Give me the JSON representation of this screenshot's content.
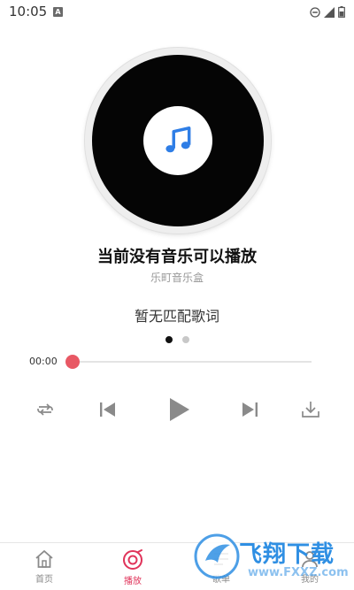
{
  "status_bar": {
    "time": "10:05",
    "app_icon_letter": "A"
  },
  "player": {
    "song_title": "当前没有音乐可以播放",
    "artist": "乐町音乐盒",
    "lyrics": "暂无匹配歌词",
    "current_time": "00:00",
    "progress": 0,
    "page_indicator": {
      "count": 2,
      "active": 0
    }
  },
  "controls": [
    "repeat-icon",
    "previous-icon",
    "play-icon",
    "next-icon",
    "download-icon"
  ],
  "bottom_nav": {
    "items": [
      {
        "label": "首页",
        "icon": "home-icon",
        "active": false
      },
      {
        "label": "播放",
        "icon": "play-disc-icon",
        "active": true
      },
      {
        "label": "歌单",
        "icon": "playlist-icon",
        "active": false
      },
      {
        "label": "我的",
        "icon": "profile-icon",
        "active": false
      }
    ]
  },
  "watermark": {
    "text": "飞翔下载",
    "url": "www.FXXZ.com"
  },
  "colors": {
    "accent": "#e85864",
    "icon_blue": "#2f7ee6",
    "disc": "#050505",
    "inactive_icon": "#9a9a9a",
    "watermark": "#2f8fe3"
  }
}
